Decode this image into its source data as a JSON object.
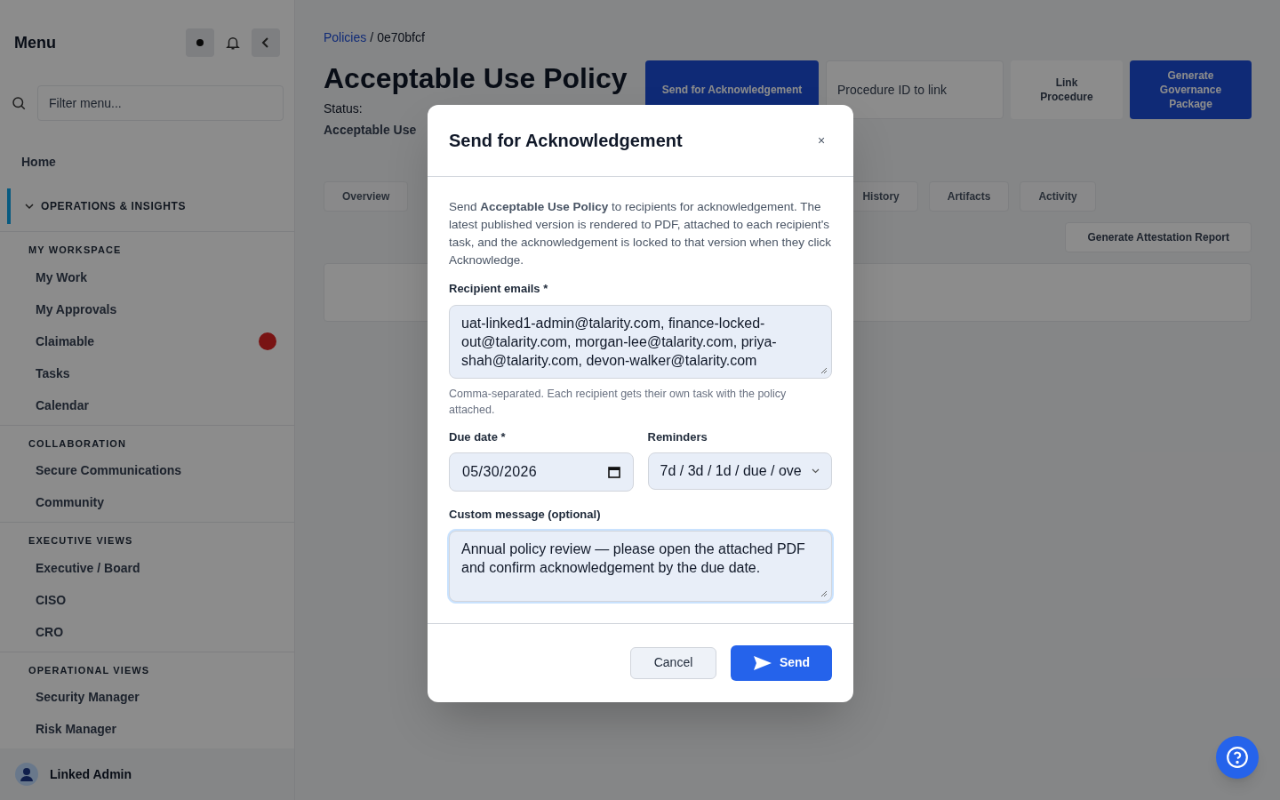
{
  "sidebar": {
    "title": "Menu",
    "filter_placeholder": "Filter menu...",
    "home": "Home",
    "section": {
      "label": "OPERATIONS & INSIGHTS",
      "expanded": true
    },
    "groups": [
      {
        "label": "MY WORKSPACE",
        "items": [
          {
            "label": "My Work",
            "alert": false
          },
          {
            "label": "My Approvals",
            "alert": false
          },
          {
            "label": "Claimable",
            "alert": true
          },
          {
            "label": "Tasks",
            "alert": false
          },
          {
            "label": "Calendar",
            "alert": false
          }
        ]
      },
      {
        "label": "COLLABORATION",
        "items": [
          {
            "label": "Secure Communications",
            "alert": false
          },
          {
            "label": "Community",
            "alert": false
          }
        ]
      },
      {
        "label": "EXECUTIVE VIEWS",
        "items": [
          {
            "label": "Executive / Board",
            "alert": false
          },
          {
            "label": "CISO",
            "alert": false
          },
          {
            "label": "CRO",
            "alert": false
          }
        ]
      },
      {
        "label": "OPERATIONAL VIEWS",
        "items": [
          {
            "label": "Security Manager",
            "alert": false
          },
          {
            "label": "Risk Manager",
            "alert": false
          }
        ]
      }
    ],
    "user": "Linked Admin"
  },
  "page": {
    "breadcrumb": [
      "Policies",
      "0e70bfcf"
    ],
    "breadcrumb_separator": "/",
    "title": "Acceptable Use Policy",
    "status_label": "Status:",
    "subtitle": "Acceptable Use",
    "actions": [
      {
        "kind": "primary",
        "label": "Send for Acknowledgement"
      },
      {
        "kind": "input",
        "label": "Procedure ID to link"
      },
      {
        "kind": "plain",
        "label": "Link Procedure"
      },
      {
        "kind": "primary",
        "label": "Generate Governance Package"
      }
    ],
    "tabs": [
      {
        "label": "Overview",
        "selected": false
      },
      {
        "label": "History",
        "selected": false
      },
      {
        "label": "Artifacts",
        "selected": false
      },
      {
        "label": "Activity",
        "selected": false
      }
    ],
    "report_button": "Generate Attestation Report"
  },
  "dialog": {
    "title": "Send for Acknowledgement",
    "close": "×",
    "intro": "Send **Acceptable Use Policy** to recipients for acknowledgement. The latest published version is rendered to PDF, attached to each recipient's task, and the acknowledgement is locked to that version when they click Acknowledge.",
    "recipients": {
      "label": "Recipient emails *",
      "value": "uat-linked1-admin@talarity.com, finance-locked-out@talarity.com, morgan-lee@talarity.com, priya-shah@talarity.com, devon-walker@talarity.com",
      "hint": "Comma-separated. Each recipient gets their own task with the policy attached."
    },
    "due_date": {
      "label": "Due date *",
      "value": "05/30/2026"
    },
    "reminders": {
      "label": "Reminders",
      "value": "7d / 3d / 1d / due / ove"
    },
    "message": {
      "label": "Custom message (optional)",
      "value": "Annual policy review — please open the attached PDF and confirm acknowledgement by the due date.",
      "focused": true
    },
    "buttons": [
      {
        "kind": "secondary",
        "label": "Cancel"
      },
      {
        "kind": "primary",
        "label": "Send"
      }
    ]
  }
}
